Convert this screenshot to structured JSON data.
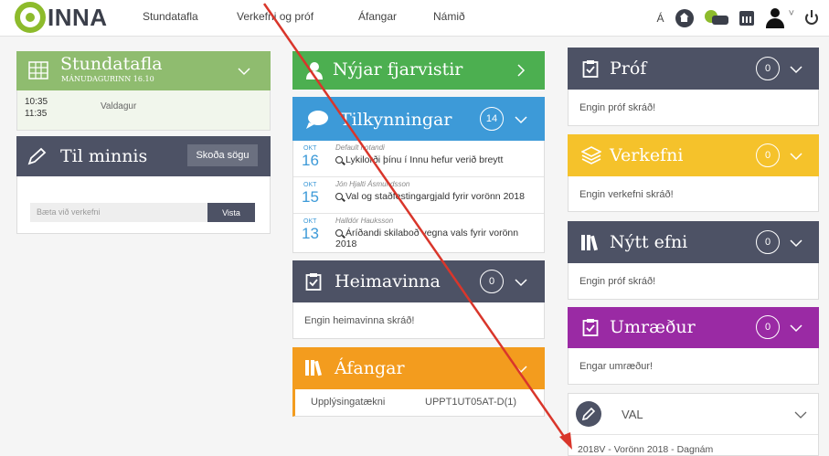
{
  "logo": {
    "text": "INNA"
  },
  "nav": {
    "items": [
      "Stundatafla",
      "Verkefni og próf",
      "Áfangar",
      "Námið"
    ]
  },
  "topright": {
    "font_size_label": "Á"
  },
  "stundatafla": {
    "title": "Stundatafla",
    "subtitle": "MÁNUDAGURINN 16.10",
    "time_start": "10:35",
    "time_end": "11:35",
    "subject": "Valdagur"
  },
  "tilminnis": {
    "title": "Til minnis",
    "history_button": "Skoða sögu",
    "input_placeholder": "Bæta við verkefni",
    "save_button": "Vista"
  },
  "fjarvistir": {
    "title": "Nýjar fjarvistir"
  },
  "tilkynningar": {
    "title": "Tilkynningar",
    "count": "14",
    "items": [
      {
        "month": "OKT",
        "day": "16",
        "author": "Default notandi",
        "text": "Lykilorði þínu í Innu hefur verið breytt"
      },
      {
        "month": "OKT",
        "day": "15",
        "author": "Jón Hjalti Ásmundsson",
        "text": "Val og staðfestingargjald fyrir vorönn 2018"
      },
      {
        "month": "OKT",
        "day": "13",
        "author": "Halldór Hauksson",
        "text": "Áríðandi skilaboð vegna vals fyrir vorönn 2018"
      }
    ]
  },
  "heimavinna": {
    "title": "Heimavinna",
    "count": "0",
    "empty": "Engin heimavinna skráð!"
  },
  "afangar": {
    "title": "Áfangar",
    "course_name": "Upplýsingatækni",
    "course_code": "UPPT1UT05AT-D(1)"
  },
  "prof": {
    "title": "Próf",
    "count": "0",
    "empty": "Engin próf skráð!"
  },
  "verkefni": {
    "title": "Verkefni",
    "count": "0",
    "empty": "Engin verkefni skráð!"
  },
  "nyttefni": {
    "title": "Nýtt efni",
    "count": "0",
    "empty": "Engin próf skráð!"
  },
  "umraedur": {
    "title": "Umræður",
    "count": "0",
    "empty": "Engar umræður!"
  },
  "val": {
    "title": "VAL",
    "item": "2018V - Vorönn 2018 - Dagnám"
  },
  "colors": {
    "green": "#8fbc6f",
    "darkgreen": "#4caf50",
    "slate": "#4d5265",
    "blue": "#3d9ad8",
    "yellow": "#f5c22b",
    "purple": "#9a2aa4",
    "orange": "#f39c1e",
    "arrow": "#d9362b"
  },
  "icons": [
    "grid-icon",
    "pencil-icon",
    "person-icon",
    "speech-bubble-icon",
    "clipboard-icon",
    "books-icon",
    "layers-icon",
    "chevron-down-icon",
    "chevron-right-icon",
    "home-icon",
    "user-icon",
    "power-icon"
  ]
}
